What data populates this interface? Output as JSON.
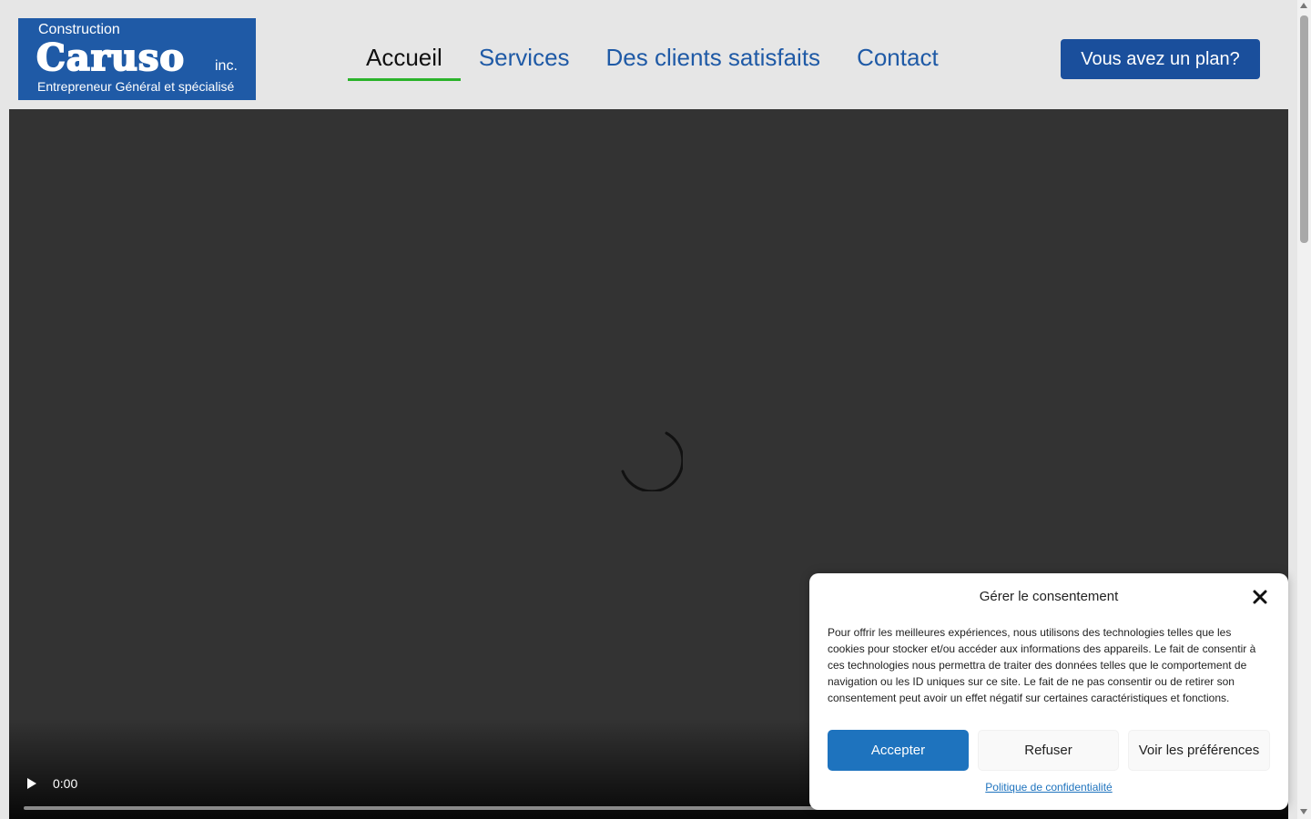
{
  "logo": {
    "line1": "Construction",
    "line2": "Caruso",
    "line3": "inc.",
    "line4": "Entrepreneur Général et spécialisé"
  },
  "nav": {
    "items": [
      {
        "label": "Accueil",
        "active": true
      },
      {
        "label": "Services"
      },
      {
        "label": "Des clients satisfaits"
      },
      {
        "label": "Contact"
      }
    ]
  },
  "cta": {
    "label": "Vous avez un plan?"
  },
  "video": {
    "time": "0:00"
  },
  "consent": {
    "title": "Gérer le consentement",
    "body": "Pour offrir les meilleures expériences, nous utilisons des technologies telles que les cookies pour stocker et/ou accéder aux informations des appareils. Le fait de consentir à ces technologies nous permettra de traiter des données telles que le comportement de navigation ou les ID uniques sur ce site. Le fait de ne pas consentir ou de retirer son consentement peut avoir un effet négatif sur certaines caractéristiques et fonctions.",
    "accept": "Accepter",
    "refuse": "Refuser",
    "preferences": "Voir les préférences",
    "policy": "Politique de confidentialité"
  },
  "colors": {
    "brand_blue": "#1f5aa6",
    "active_underline": "#2bb32b",
    "accept_button": "#1e73be"
  }
}
